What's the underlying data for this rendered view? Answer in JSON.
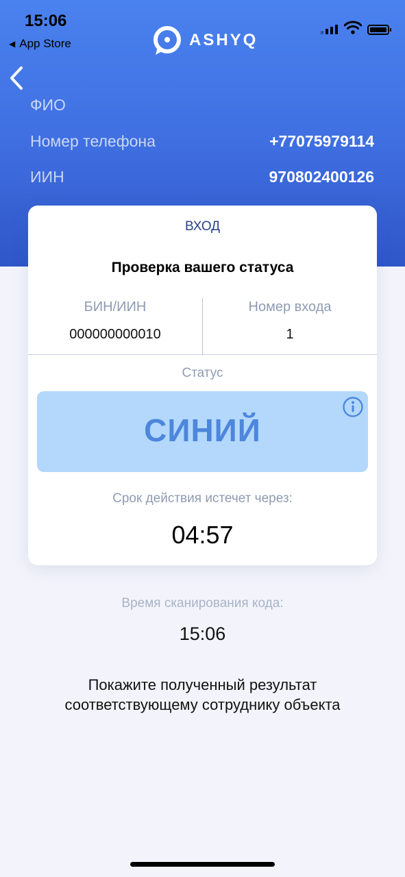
{
  "status_bar": {
    "time": "15:06",
    "back_app_label": "App Store"
  },
  "header": {
    "logo_text": "ASHYQ",
    "fields": [
      {
        "label": "ФИО",
        "value": ""
      },
      {
        "label": "Номер телефона",
        "value": "+77075979114"
      },
      {
        "label": "ИИН",
        "value": "970802400126"
      }
    ]
  },
  "card": {
    "entry_title": "ВХОД",
    "check_title": "Проверка вашего статуса",
    "bin_label": "БИН/ИИН",
    "bin_value": "000000000010",
    "entrance_label": "Номер входа",
    "entrance_value": "1",
    "status_label": "Статус",
    "status_value": "СИНИЙ",
    "status_color": "#b3d8fb",
    "status_text_color": "#4d86dc",
    "expire_label": "Срок действия истечет через:",
    "timer": "04:57"
  },
  "scan": {
    "label": "Время сканирования кода:",
    "time": "15:06"
  },
  "instructions": "Покажите полученный результат соответствующему сотруднику объекта",
  "icons": {
    "back": "chevron-left-icon",
    "info": "info-icon",
    "logo": "chat-bubble-logo-icon"
  },
  "colors": {
    "header_top": "#4a82ef",
    "header_bottom": "#2f56c8",
    "accent": "#26428b"
  }
}
